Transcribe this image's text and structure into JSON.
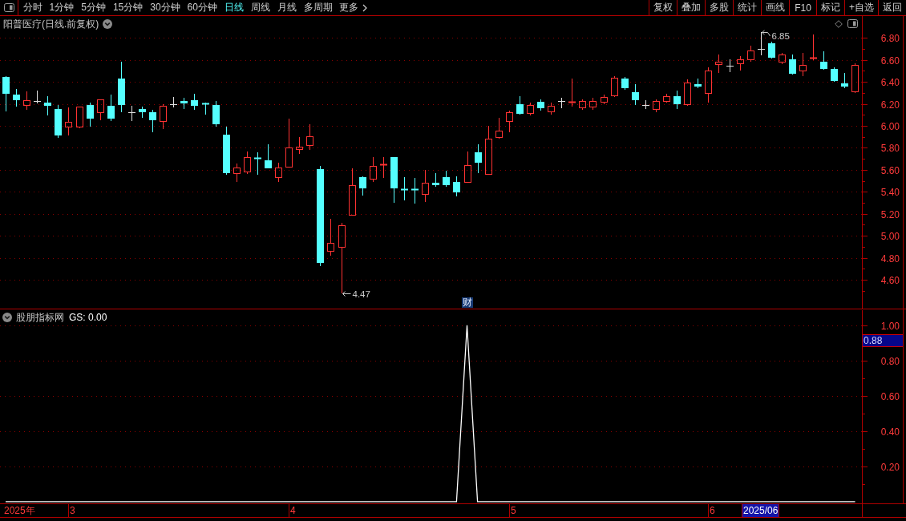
{
  "toolbar": {
    "periods": [
      {
        "label": "分时",
        "selected": false
      },
      {
        "label": "1分钟",
        "selected": false
      },
      {
        "label": "5分钟",
        "selected": false
      },
      {
        "label": "15分钟",
        "selected": false
      },
      {
        "label": "30分钟",
        "selected": false
      },
      {
        "label": "60分钟",
        "selected": false
      },
      {
        "label": "日线",
        "selected": true
      },
      {
        "label": "周线",
        "selected": false
      },
      {
        "label": "月线",
        "selected": false
      },
      {
        "label": "多周期",
        "selected": false
      }
    ],
    "more": "更多",
    "actions": [
      "复权",
      "叠加",
      "多股",
      "统计",
      "画线",
      "F10",
      "标记",
      "+自选",
      "返回"
    ]
  },
  "price_panel": {
    "title": "阳普医疗(日线.前复权)",
    "axis_ticks": [
      "6.80",
      "6.60",
      "6.40",
      "6.20",
      "6.00",
      "5.80",
      "5.60",
      "5.40",
      "5.20",
      "5.00",
      "4.80",
      "4.60"
    ],
    "high_label": "6.85",
    "low_label": "4.47",
    "event_marker": "财"
  },
  "indicator_panel": {
    "name": "股朋指标网",
    "readout": "GS: 0.00",
    "cursor_value": "0.88",
    "chart_data": {
      "type": "line",
      "values": [
        0,
        0,
        0,
        0,
        0,
        0,
        0,
        0,
        0,
        0,
        0,
        0,
        0,
        0,
        0,
        0,
        0,
        0,
        0,
        0,
        0,
        0,
        0,
        0,
        0,
        0,
        0,
        0,
        0,
        0,
        0,
        0,
        0,
        0,
        0,
        0,
        0,
        0,
        0,
        0,
        0,
        0,
        0,
        0,
        1,
        0,
        0,
        0,
        0,
        0,
        0,
        0,
        0,
        0,
        0,
        0,
        0,
        0,
        0,
        0,
        0,
        0,
        0,
        0,
        0,
        0,
        0,
        0,
        0,
        0,
        0,
        0,
        0,
        0,
        0,
        0,
        0,
        0,
        0,
        0,
        0,
        0
      ],
      "ylim": [
        -0.01,
        1.09
      ],
      "yticks": [
        {
          "value": 1,
          "label": "1.00"
        },
        {
          "value": 0.8,
          "label": "0.80"
        },
        {
          "value": 0.6,
          "label": "0.60"
        },
        {
          "value": 0.4,
          "label": "0.40"
        },
        {
          "value": 0.2,
          "label": "0.20"
        }
      ],
      "grid": true
    }
  },
  "date_axis": {
    "labels": [
      "2025年",
      "3",
      "4",
      "5",
      "6"
    ],
    "cursor_date": "2025/06"
  }
}
